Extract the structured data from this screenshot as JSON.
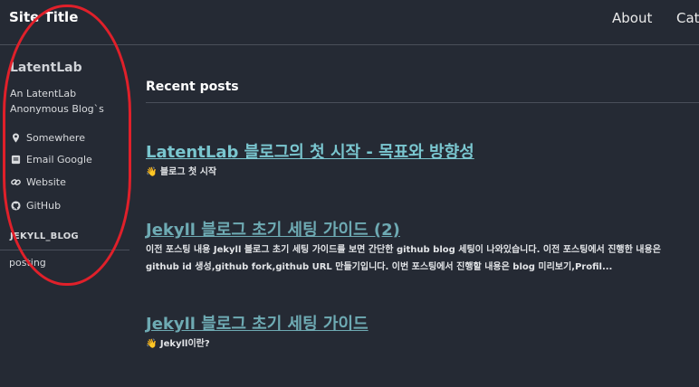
{
  "masthead": {
    "site_title": "Site Title",
    "nav": [
      "About",
      "Cate"
    ]
  },
  "sidebar": {
    "author_name": "LatentLab",
    "author_bio": "An LatentLab Anonymous Blog`s",
    "links": [
      {
        "label": "Somewhere",
        "icon": "location-pin-icon"
      },
      {
        "label": "Email Google",
        "icon": "envelope-icon"
      },
      {
        "label": "Website",
        "icon": "link-icon"
      },
      {
        "label": "GitHub",
        "icon": "github-icon"
      }
    ],
    "nav_heading": "JEKYLL_BLOG",
    "nav_items": [
      "posting"
    ]
  },
  "annotation": {
    "color": "#e0202a"
  },
  "main": {
    "section_title": "Recent posts",
    "posts": [
      {
        "title": "LatentLab 블로그의 첫 시작 - 목표와 방향성",
        "excerpt": "👋 블로그 첫 시작"
      },
      {
        "title": "Jekyll 블로그 초기 세팅 가이드 (2)",
        "excerpt": "이전 포스팅 내용 Jekyll 블로그 초기 세팅 가이드를 보면 간단한 github blog 세팅이 나와있습니다. 이전 포스팅에서 진행한 내용은 github id 생성,github fork,github URL 만들기입니다. 이번 포스팅에서 진행할 내용은 blog 미리보기,Profil..."
      },
      {
        "title": "Jekyll 블로그 초기 세팅 가이드",
        "excerpt": "👋 Jekyll이란?"
      }
    ]
  }
}
